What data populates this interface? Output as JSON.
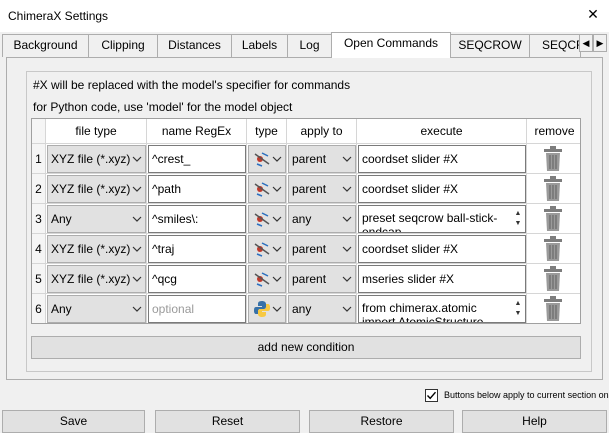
{
  "window": {
    "title": "ChimeraX Settings",
    "close_glyph": "✕"
  },
  "tabs": [
    {
      "label": "Background",
      "active": false
    },
    {
      "label": "Clipping",
      "active": false
    },
    {
      "label": "Distances",
      "active": false
    },
    {
      "label": "Labels",
      "active": false
    },
    {
      "label": "Log",
      "active": false
    },
    {
      "label": "Open Commands",
      "active": true
    },
    {
      "label": "SEQCROW",
      "active": false
    },
    {
      "label": "SEQCR",
      "active": false
    }
  ],
  "tab_scroll": {
    "left": "◀",
    "right": "▶"
  },
  "info": {
    "line1": "#X will be replaced with the model's specifier for commands",
    "line2": "for Python code, use 'model' for the model object"
  },
  "table": {
    "columns": [
      "file type",
      "name RegEx",
      "type",
      "apply to",
      "execute",
      "remove"
    ],
    "rows": [
      {
        "num": "1",
        "file_type": "XYZ file (*.xyz)",
        "name_regex": "^crest_",
        "name_placeholder": false,
        "type_icon": "chimerax-command-icon",
        "apply_to": "parent",
        "execute": "coordset slider #X",
        "execute_multi": false,
        "remove_icon": "trash-icon"
      },
      {
        "num": "2",
        "file_type": "XYZ file (*.xyz)",
        "name_regex": "^path",
        "name_placeholder": false,
        "type_icon": "chimerax-command-icon",
        "apply_to": "parent",
        "execute": "coordset slider #X",
        "execute_multi": false,
        "remove_icon": "trash-icon"
      },
      {
        "num": "3",
        "file_type": "Any",
        "name_regex": "^smiles\\:",
        "name_placeholder": false,
        "type_icon": "chimerax-command-icon",
        "apply_to": "any",
        "execute": "preset seqcrow ball-stick-endcap",
        "execute_multi": true,
        "remove_icon": "trash-icon"
      },
      {
        "num": "4",
        "file_type": "XYZ file (*.xyz)",
        "name_regex": "^traj",
        "name_placeholder": false,
        "type_icon": "chimerax-command-icon",
        "apply_to": "parent",
        "execute": "coordset slider #X",
        "execute_multi": false,
        "remove_icon": "trash-icon"
      },
      {
        "num": "5",
        "file_type": "XYZ file (*.xyz)",
        "name_regex": "^qcg",
        "name_placeholder": false,
        "type_icon": "chimerax-command-icon",
        "apply_to": "parent",
        "execute": "mseries slider #X",
        "execute_multi": false,
        "remove_icon": "trash-icon"
      },
      {
        "num": "6",
        "file_type": "Any",
        "name_regex": "optional",
        "name_placeholder": true,
        "type_icon": "python-icon",
        "apply_to": "any",
        "execute": "from chimerax.atomic import AtomicStructure",
        "execute_multi": true,
        "remove_icon": "trash-icon"
      }
    ]
  },
  "add_condition_label": "add new condition",
  "apply_current_checkbox": {
    "label": "Buttons below apply to current section only",
    "checked": true
  },
  "buttons": {
    "save": "Save",
    "reset": "Reset",
    "restore": "Restore",
    "help": "Help"
  },
  "colors": {
    "window_bg": "#f0f0f0",
    "button_bg": "#e1e1e1",
    "border": "#adadad",
    "python_blue": "#3771a8",
    "python_yellow": "#f7c942",
    "chimerax_red": "#c0392b"
  }
}
